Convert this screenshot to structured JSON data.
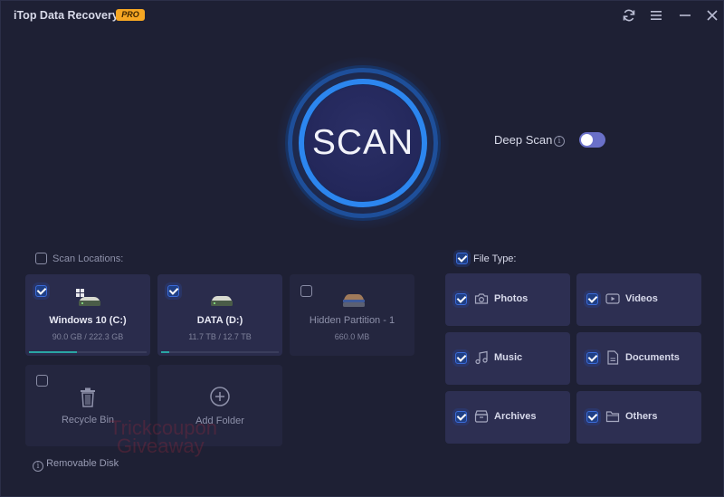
{
  "app": {
    "title": "iTop Data Recovery",
    "badge": "PRO",
    "window_controls": {
      "refresh_icon": "refresh-icon",
      "menu_icon": "hamburger-menu-icon",
      "minimize_icon": "minimize-icon",
      "close_icon": "close-icon"
    }
  },
  "scan": {
    "button_label": "SCAN",
    "deep_scan_label": "Deep Scan",
    "deep_scan_enabled": false
  },
  "locations": {
    "header": "Scan Locations:",
    "header_checked": false,
    "items": [
      {
        "name": "Windows 10 (C:)",
        "size": "90.0 GB / 222.3 GB",
        "checked": true,
        "used_fraction": 0.405,
        "icon": "windows-drive-icon"
      },
      {
        "name": "DATA (D:)",
        "size": "11.7 TB / 12.7 TB",
        "checked": true,
        "used_fraction": 0.07,
        "icon": "drive-icon"
      },
      {
        "name": "Hidden Partition - 1",
        "size": "660.0 MB",
        "checked": false,
        "icon": "hidden-drive-icon"
      },
      {
        "name": "Recycle Bin",
        "checked": false,
        "icon": "trash-icon"
      },
      {
        "name": "Add Folder",
        "icon": "plus-circle-icon"
      }
    ],
    "removable_disk": "Removable Disk"
  },
  "file_types": {
    "header": "File Type:",
    "header_checked": true,
    "items": [
      {
        "label": "Photos",
        "checked": true,
        "icon": "camera-icon"
      },
      {
        "label": "Videos",
        "checked": true,
        "icon": "video-icon"
      },
      {
        "label": "Music",
        "checked": true,
        "icon": "music-note-icon"
      },
      {
        "label": "Documents",
        "checked": true,
        "icon": "document-icon"
      },
      {
        "label": "Archives",
        "checked": true,
        "icon": "archive-icon"
      },
      {
        "label": "Others",
        "checked": true,
        "icon": "folder-icon"
      }
    ]
  },
  "watermark": {
    "line1": "Trickcoupon",
    "line2": "Giveaway"
  },
  "colors": {
    "background": "#1e2034",
    "accent": "#2c86ef",
    "pro_badge": "#f5a623",
    "progress": "#2aa6a3",
    "toggle": "#6a70c8"
  }
}
